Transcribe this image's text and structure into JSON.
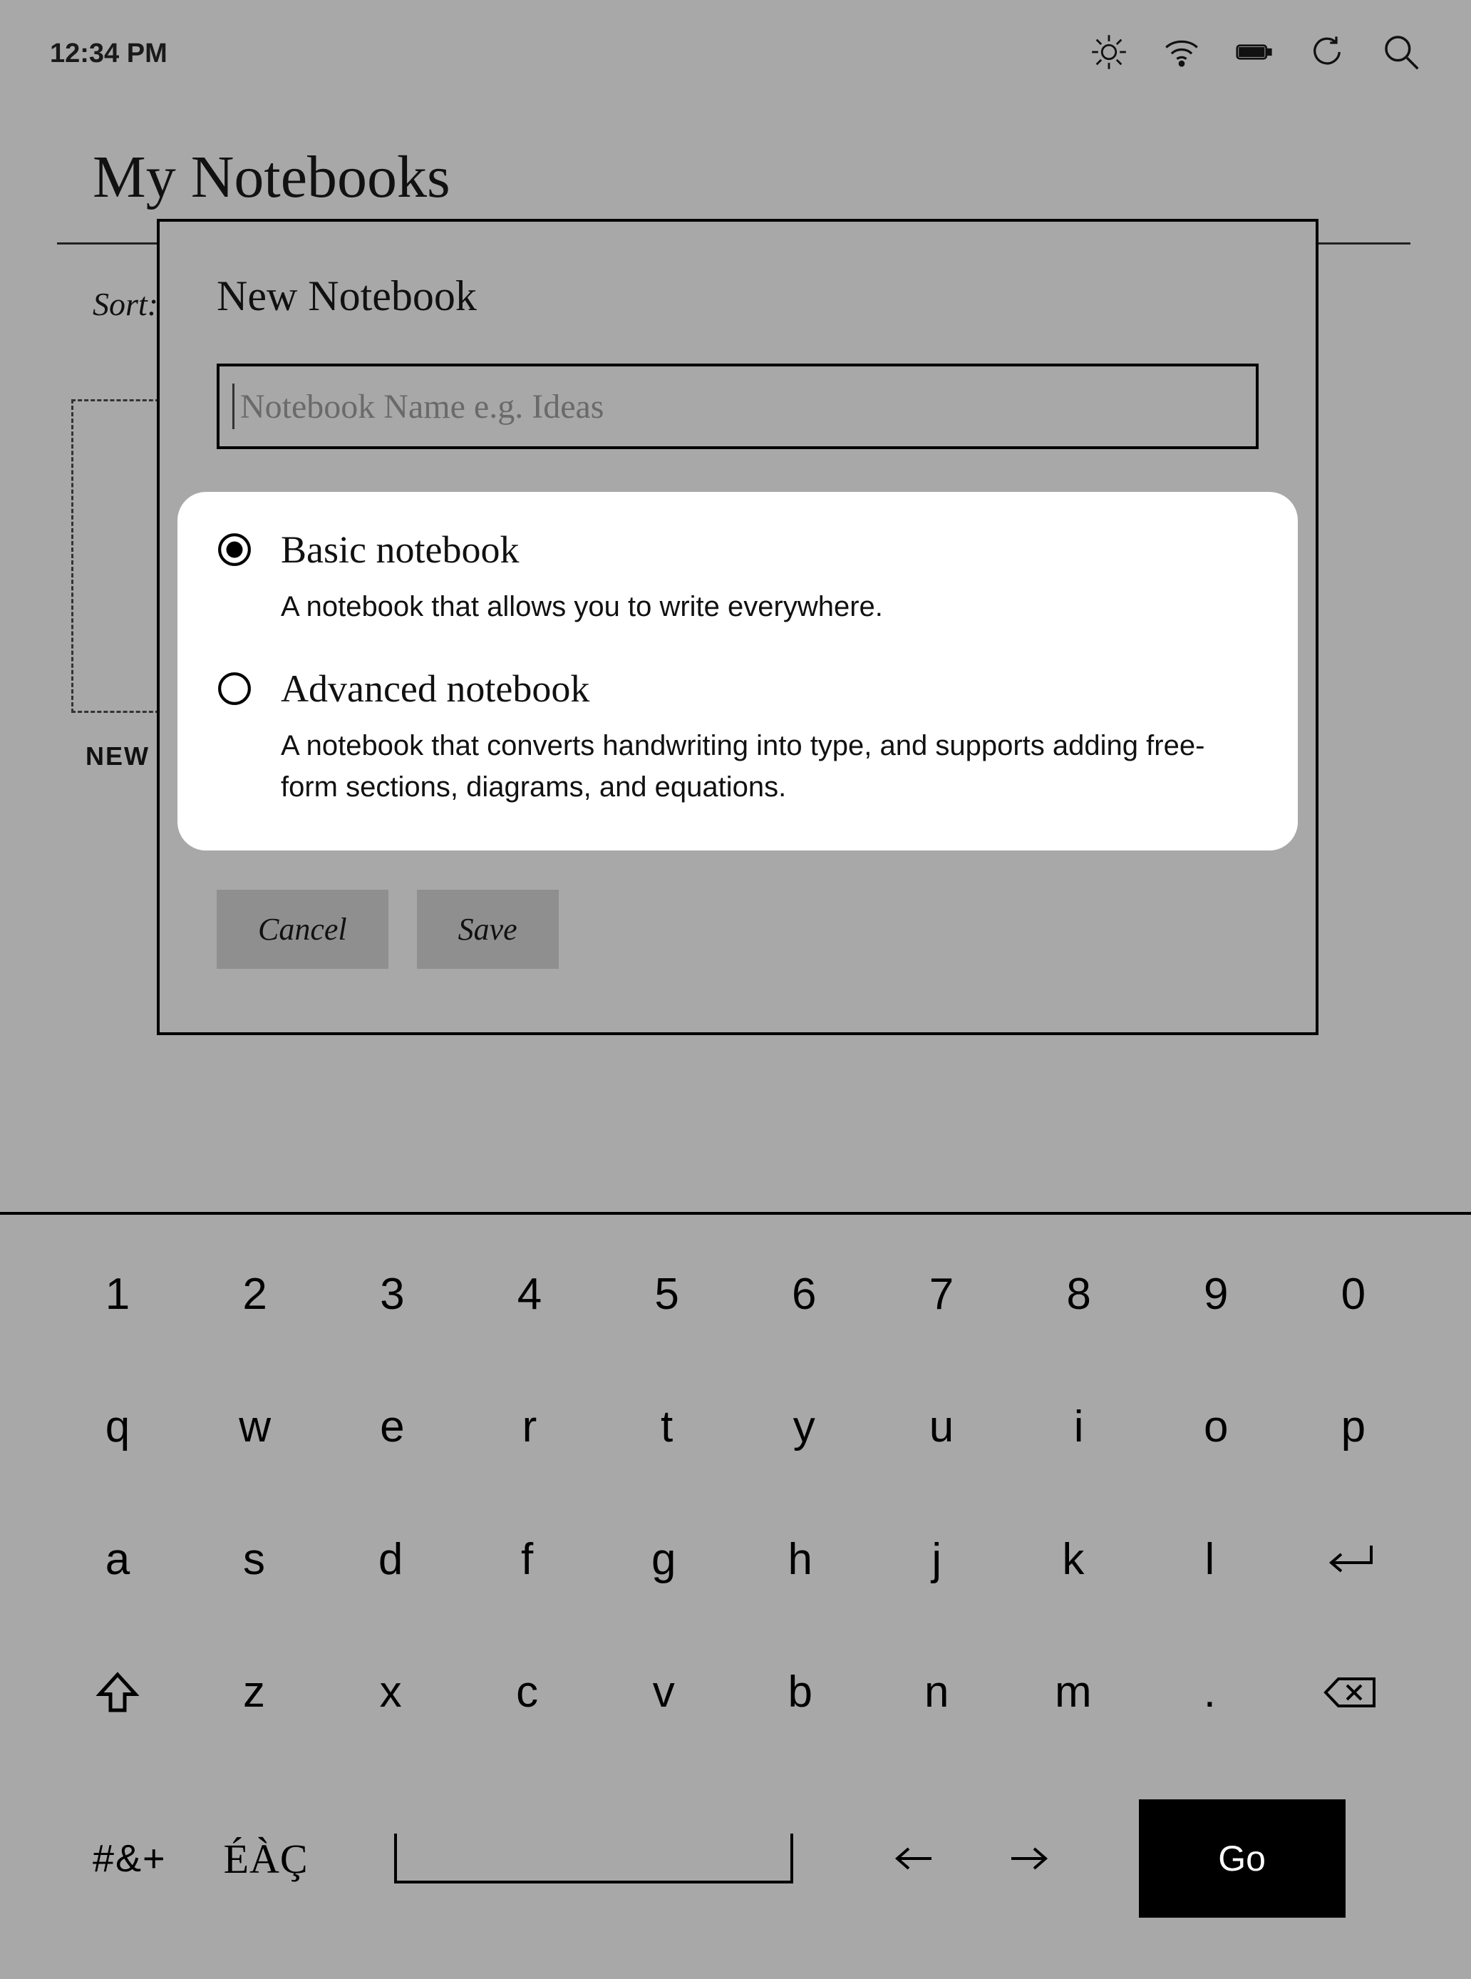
{
  "status": {
    "time": "12:34 PM"
  },
  "page": {
    "title": "My Notebooks",
    "sort_label": "Sort:",
    "new_tile_label": "NEW"
  },
  "dialog": {
    "title": "New Notebook",
    "name_placeholder": "Notebook Name e.g. Ideas",
    "name_value": "",
    "options": [
      {
        "selected": true,
        "title": "Basic notebook",
        "description": "A notebook that allows you to write everywhere."
      },
      {
        "selected": false,
        "title": "Advanced notebook",
        "description": "A notebook that converts handwriting into type, and supports adding free-form sections, diagrams, and equations."
      }
    ],
    "cancel_label": "Cancel",
    "save_label": "Save"
  },
  "keyboard": {
    "row1": [
      "1",
      "2",
      "3",
      "4",
      "5",
      "6",
      "7",
      "8",
      "9",
      "0"
    ],
    "row2": [
      "q",
      "w",
      "e",
      "r",
      "t",
      "y",
      "u",
      "i",
      "o",
      "p"
    ],
    "row3": [
      "a",
      "s",
      "d",
      "f",
      "g",
      "h",
      "j",
      "k",
      "l"
    ],
    "row4": [
      "z",
      "x",
      "c",
      "v",
      "b",
      "n",
      "m",
      "."
    ],
    "switch_label": "#&+",
    "accents_label": "ÉÀÇ",
    "go_label": "Go"
  }
}
